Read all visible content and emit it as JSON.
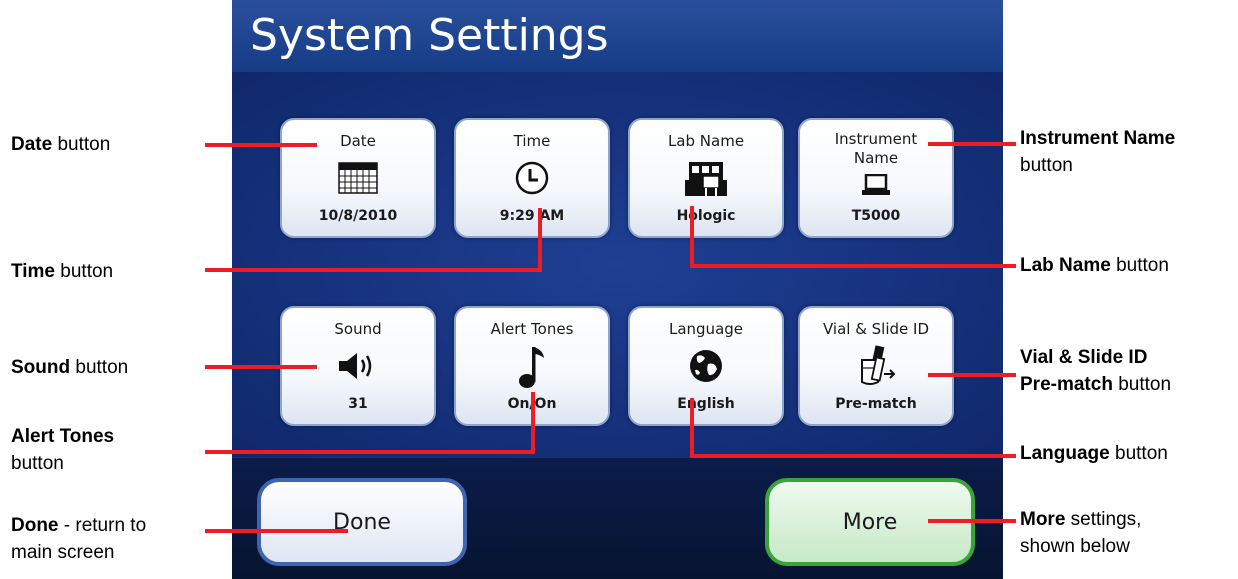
{
  "screen": {
    "title": "System Settings"
  },
  "tiles": [
    {
      "label": "Date",
      "value": "10/8/2010"
    },
    {
      "label": "Time",
      "value": "9:29 AM"
    },
    {
      "label": "Lab Name",
      "value": "Hologic"
    },
    {
      "label": "Instrument Name",
      "value": "T5000"
    },
    {
      "label": "Sound",
      "value": "31"
    },
    {
      "label": "Alert Tones",
      "value": "On/On"
    },
    {
      "label": "Language",
      "value": "English"
    },
    {
      "label": "Vial & Slide ID",
      "value": "Pre-match"
    }
  ],
  "buttons": {
    "done": "Done",
    "more": "More"
  },
  "callouts": {
    "date": {
      "bold": "Date",
      "rest": " button"
    },
    "time": {
      "bold": "Time",
      "rest": " button"
    },
    "sound": {
      "bold": "Sound",
      "rest": " button"
    },
    "alert": {
      "bold": "Alert Tones",
      "rest": "button"
    },
    "done": {
      "bold": "Done",
      "rest1": " - return to",
      "rest2": "main screen"
    },
    "instrument": {
      "bold": "Instrument Name",
      "rest": "button"
    },
    "lab": {
      "bold": "Lab Name",
      "rest": " button"
    },
    "vial": {
      "bold1": "Vial & Slide ID",
      "bold2": "Pre-match",
      "rest": " button"
    },
    "language": {
      "bold": "Language",
      "rest": " button"
    },
    "more": {
      "bold": "More",
      "rest1": " settings,",
      "rest2": "shown below"
    }
  },
  "colors": {
    "callout_line": "#ee1c25",
    "screen_bg": "#142f78",
    "done_border": "#3f64b0",
    "more_border": "#3aa33a"
  }
}
